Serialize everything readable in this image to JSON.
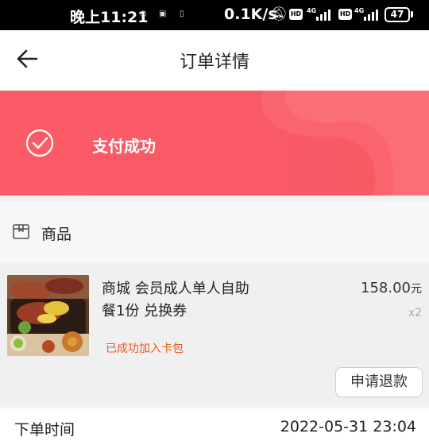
{
  "status_bar": {
    "time": "晚上11:21",
    "speed": "0.1K/s",
    "hd": "HD",
    "network": "4G",
    "battery": "47"
  },
  "nav": {
    "title": "订单详情",
    "back_icon": "arrow-left-icon"
  },
  "banner": {
    "status_text": "支付成功",
    "icon": "check-circle-icon",
    "color": "#fa5a66"
  },
  "section": {
    "label": "商品",
    "icon": "package-icon"
  },
  "product": {
    "name": "商城 会员成人单人自助餐1份 兑换券",
    "price": "158.00",
    "currency": "元",
    "quantity": "x2",
    "tag": "已成功加入卡包",
    "refund_button": "申请退款",
    "accent_color": "#f0561b"
  },
  "order_info": {
    "time_label": "下单时间",
    "time_value": "2022-05-31 23:04"
  }
}
